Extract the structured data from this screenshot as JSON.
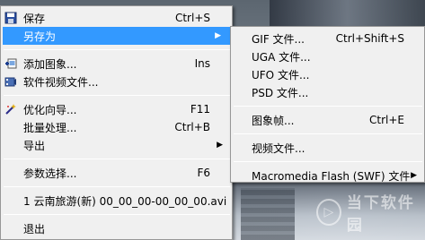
{
  "file_menu": {
    "save": {
      "label": "保存",
      "shortcut": "Ctrl+S",
      "icon": "floppy-disk-icon"
    },
    "save_as": {
      "label": "另存为",
      "icon": "none"
    },
    "add_image": {
      "label": "添加图象...",
      "shortcut": "Ins",
      "icon": "add-image-icon"
    },
    "video_file": {
      "label": "软件视频文件...",
      "icon": "film-icon"
    },
    "optimize_wizard": {
      "label": "优化向导...",
      "shortcut": "F11",
      "icon": "magic-wand-icon"
    },
    "batch_process": {
      "label": "批量处理...",
      "shortcut": "Ctrl+B"
    },
    "export": {
      "label": "导出"
    },
    "preferences": {
      "label": "参数选择...",
      "shortcut": "F6"
    },
    "recent_file": {
      "label": "1 云南旅游(新) 00_00_00-00_00_00.avi"
    },
    "exit": {
      "label": "退出"
    }
  },
  "save_as_submenu": {
    "gif": {
      "label": "GIF 文件...",
      "shortcut": "Ctrl+Shift+S"
    },
    "uga": {
      "label": "UGA 文件..."
    },
    "ufo": {
      "label": "UFO 文件..."
    },
    "psd": {
      "label": "PSD 文件..."
    },
    "image_frame": {
      "label": "图象帧...",
      "shortcut": "Ctrl+E"
    },
    "video_file": {
      "label": "视频文件..."
    },
    "flash": {
      "label": "Macromedia Flash (SWF) 文件"
    }
  },
  "colors": {
    "highlight": "#3399ff",
    "menu_bg": "#f0f0f0"
  }
}
